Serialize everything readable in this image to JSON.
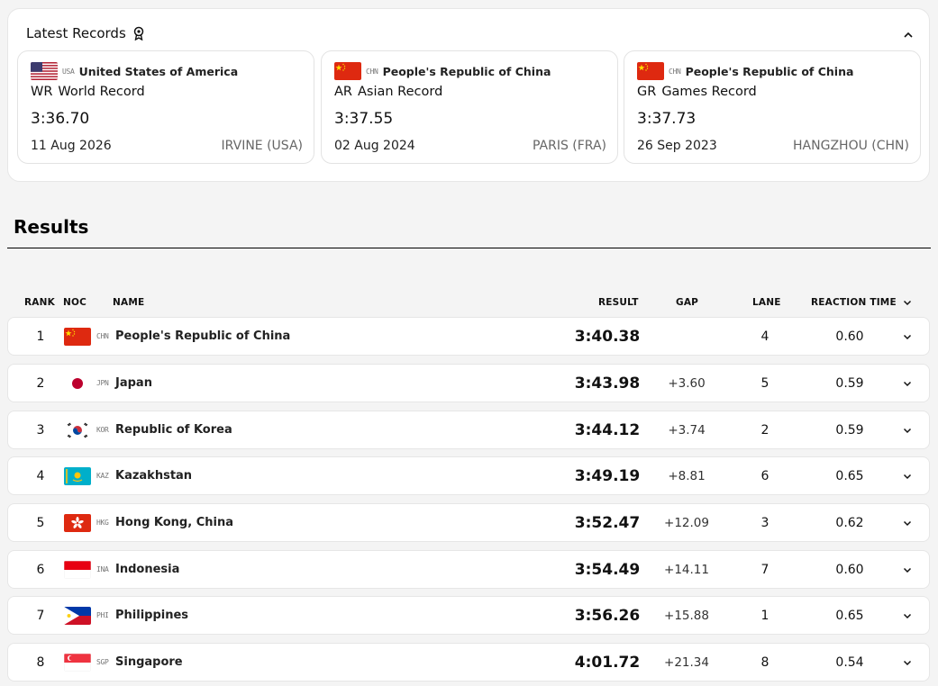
{
  "latest_records": {
    "title": "Latest Records",
    "cards": [
      {
        "noc": "USA",
        "country": "United States of America",
        "abbr": "WR",
        "record_name": "World Record",
        "time": "3:36.70",
        "date": "11 Aug 2026",
        "venue": "IRVINE (USA)",
        "flag": "usa"
      },
      {
        "noc": "CHN",
        "country": "People's Republic of China",
        "abbr": "AR",
        "record_name": "Asian Record",
        "time": "3:37.55",
        "date": "02 Aug 2024",
        "venue": "PARIS (FRA)",
        "flag": "chn"
      },
      {
        "noc": "CHN",
        "country": "People's Republic of China",
        "abbr": "GR",
        "record_name": "Games Record",
        "time": "3:37.73",
        "date": "26 Sep 2023",
        "venue": "HANGZHOU (CHN)",
        "flag": "chn"
      }
    ]
  },
  "results": {
    "title": "Results",
    "columns": {
      "rank": "RANK",
      "noc": "NOC",
      "name": "NAME",
      "result": "RESULT",
      "gap": "GAP",
      "lane": "LANE",
      "reaction": "REACTION TIME"
    },
    "rows": [
      {
        "rank": "1",
        "noc": "CHN",
        "name": "People's Republic of China",
        "result": "3:40.38",
        "gap": "",
        "lane": "4",
        "reaction": "0.60",
        "flag": "chn"
      },
      {
        "rank": "2",
        "noc": "JPN",
        "name": "Japan",
        "result": "3:43.98",
        "gap": "+3.60",
        "lane": "5",
        "reaction": "0.59",
        "flag": "jpn"
      },
      {
        "rank": "3",
        "noc": "KOR",
        "name": "Republic of Korea",
        "result": "3:44.12",
        "gap": "+3.74",
        "lane": "2",
        "reaction": "0.59",
        "flag": "kor"
      },
      {
        "rank": "4",
        "noc": "KAZ",
        "name": "Kazakhstan",
        "result": "3:49.19",
        "gap": "+8.81",
        "lane": "6",
        "reaction": "0.65",
        "flag": "kaz"
      },
      {
        "rank": "5",
        "noc": "HKG",
        "name": "Hong Kong, China",
        "result": "3:52.47",
        "gap": "+12.09",
        "lane": "3",
        "reaction": "0.62",
        "flag": "hkg"
      },
      {
        "rank": "6",
        "noc": "INA",
        "name": "Indonesia",
        "result": "3:54.49",
        "gap": "+14.11",
        "lane": "7",
        "reaction": "0.60",
        "flag": "ina"
      },
      {
        "rank": "7",
        "noc": "PHI",
        "name": "Philippines",
        "result": "3:56.26",
        "gap": "+15.88",
        "lane": "1",
        "reaction": "0.65",
        "flag": "phi"
      },
      {
        "rank": "8",
        "noc": "SGP",
        "name": "Singapore",
        "result": "4:01.72",
        "gap": "+21.34",
        "lane": "8",
        "reaction": "0.54",
        "flag": "sgp"
      }
    ]
  },
  "icons": {
    "records": "medal-icon",
    "collapse": "chevron-up-icon",
    "row_expand": "chevron-down-icon"
  }
}
